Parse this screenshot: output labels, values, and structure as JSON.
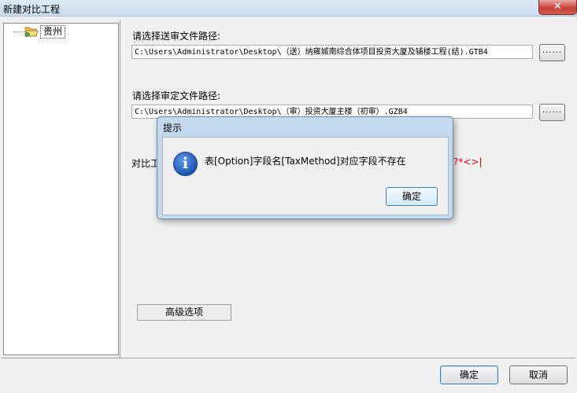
{
  "window": {
    "title": "新建对比工程",
    "close_glyph": "✕"
  },
  "tree": {
    "items": [
      {
        "label": "贵州",
        "icon": "folder-open-icon"
      }
    ]
  },
  "form": {
    "send_label": "请选择送审文件路径:",
    "send_path": "C:\\Users\\Administrator\\Desktop\\（送）纳雍城南综合体项目投资大厦及辅楼工程(结).GTB4",
    "approve_label": "请选择审定文件路径:",
    "approve_path": "C:\\Users\\Administrator\\Desktop\\（审）投资大厦主楼（初审）.GZB4",
    "browse_label": "......",
    "compare_label_partial": "对比工",
    "hidden_chars": "?*<>|",
    "advanced_button": "高级选项"
  },
  "footer": {
    "ok": "确定",
    "cancel": "取消"
  },
  "dialog": {
    "title": "提示",
    "message": "表[Option]字段名[TaxMethod]对应字段不存在",
    "ok": "确定",
    "icon": "info-icon"
  }
}
